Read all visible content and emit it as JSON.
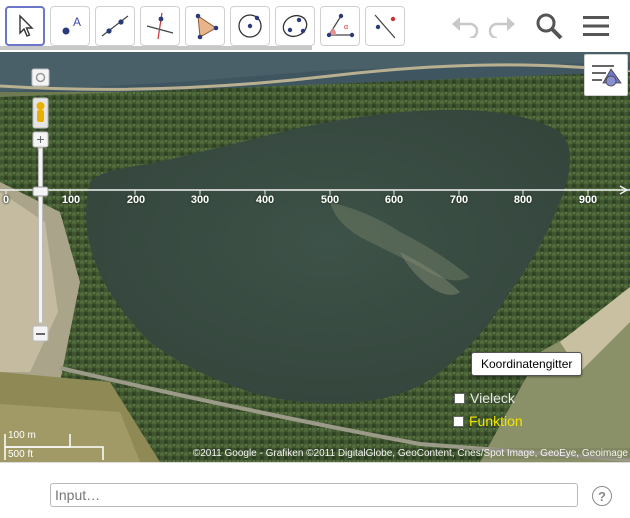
{
  "toolbar": {
    "tools": [
      {
        "name": "move-tool",
        "icon": "cursor-arrow-icon"
      },
      {
        "name": "point-tool",
        "icon": "point-icon"
      },
      {
        "name": "line-tool",
        "icon": "line-through-points-icon"
      },
      {
        "name": "perpendicular-line-tool",
        "icon": "perpendicular-line-icon"
      },
      {
        "name": "polygon-tool",
        "icon": "polygon-icon"
      },
      {
        "name": "circle-tool",
        "icon": "circle-center-point-icon"
      },
      {
        "name": "conic-tool",
        "icon": "ellipse-icon"
      },
      {
        "name": "angle-tool",
        "icon": "angle-icon"
      },
      {
        "name": "reflect-tool",
        "icon": "reflect-about-line-icon"
      }
    ],
    "active_tool": "move-tool",
    "right_icons": [
      "undo-icon",
      "redo-icon",
      "search-icon",
      "menu-icon"
    ]
  },
  "graphics": {
    "x_axis_ticks": [
      "0",
      "100",
      "200",
      "300",
      "400",
      "500",
      "600",
      "700",
      "800",
      "900"
    ],
    "grid_button_label": "Koordinatengitter",
    "checkboxes": [
      {
        "label": "Vieleck",
        "checked": false,
        "color": "#e8e8e8"
      },
      {
        "label": "Funktion",
        "checked": false,
        "color": "#f2e600"
      }
    ],
    "scale": {
      "metric": "100 m",
      "imperial": "500 ft"
    },
    "attribution": "©2011 Google - Grafiken ©2011 DigitalGlobe, GeoContent, Cnes/Spot Image, GeoEye, Geoimage"
  },
  "input_bar": {
    "placeholder": "Input…",
    "help_label": "?"
  },
  "colors": {
    "accent": "#6b77c9",
    "lake": "#3a4e44",
    "forest": "#3f5530",
    "fields": "#8a8a62"
  }
}
